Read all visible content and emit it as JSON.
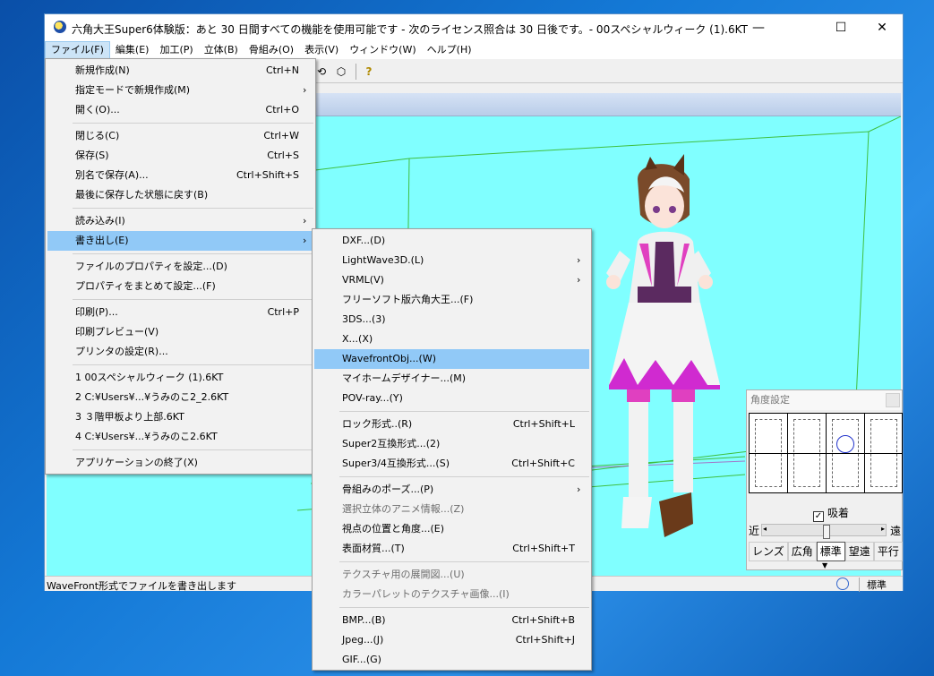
{
  "window": {
    "title": "六角大王Super6体験版：あと 30 日間すべての機能を使用可能です - 次のライセンス照合は 30 日後です。- 00スペシャルウィーク (1).6KT",
    "minimize": "—",
    "maximize": "☐",
    "close": "✕"
  },
  "menubar": [
    {
      "label": "ファイル(F)",
      "active": true
    },
    {
      "label": "編集(E)"
    },
    {
      "label": "加工(P)"
    },
    {
      "label": "立体(B)"
    },
    {
      "label": "骨組み(O)"
    },
    {
      "label": "表示(V)"
    },
    {
      "label": "ウィンドウ(W)"
    },
    {
      "label": "ヘルプ(H)"
    }
  ],
  "toolbar": {
    "help_icon": "?"
  },
  "file_menu": [
    {
      "label": "新規作成(N)",
      "shortcut": "Ctrl+N"
    },
    {
      "label": "指定モードで新規作成(M)",
      "submenu": true
    },
    {
      "label": "開く(O)...",
      "shortcut": "Ctrl+O"
    },
    {
      "sep": true
    },
    {
      "label": "閉じる(C)",
      "shortcut": "Ctrl+W"
    },
    {
      "label": "保存(S)",
      "shortcut": "Ctrl+S"
    },
    {
      "label": "別名で保存(A)...",
      "shortcut": "Ctrl+Shift+S"
    },
    {
      "label": "最後に保存した状態に戻す(B)"
    },
    {
      "sep": true
    },
    {
      "label": "読み込み(I)",
      "submenu": true
    },
    {
      "label": "書き出し(E)",
      "submenu": true,
      "highlighted": true
    },
    {
      "sep": true
    },
    {
      "label": "ファイルのプロパティを設定...(D)"
    },
    {
      "label": "プロパティをまとめて設定...(F)"
    },
    {
      "sep": true
    },
    {
      "label": "印刷(P)...",
      "shortcut": "Ctrl+P"
    },
    {
      "label": "印刷プレビュー(V)"
    },
    {
      "label": "プリンタの設定(R)..."
    },
    {
      "sep": true
    },
    {
      "label": "1 00スペシャルウィーク (1).6KT"
    },
    {
      "label": "2 C:¥Users¥...¥うみのこ2_2.6KT"
    },
    {
      "label": "3 ３階甲板より上部.6KT"
    },
    {
      "label": "4 C:¥Users¥...¥うみのこ2.6KT"
    },
    {
      "sep": true
    },
    {
      "label": "アプリケーションの終了(X)"
    }
  ],
  "export_menu": [
    {
      "label": "DXF...(D)"
    },
    {
      "label": "LightWave3D.(L)",
      "submenu": true
    },
    {
      "label": "VRML(V)",
      "submenu": true
    },
    {
      "label": "フリーソフト版六角大王...(F)"
    },
    {
      "label": "3DS...(3)"
    },
    {
      "label": "X...(X)"
    },
    {
      "label": "WavefrontObj...(W)",
      "highlighted": true
    },
    {
      "label": "マイホームデザイナー...(M)"
    },
    {
      "label": "POV-ray...(Y)"
    },
    {
      "sep": true
    },
    {
      "label": "ロック形式..(R)",
      "shortcut": "Ctrl+Shift+L"
    },
    {
      "label": "Super2互換形式...(2)"
    },
    {
      "label": "Super3/4互換形式...(S)",
      "shortcut": "Ctrl+Shift+C"
    },
    {
      "sep": true
    },
    {
      "label": "骨組みのポーズ...(P)",
      "submenu": true
    },
    {
      "label": "選択立体のアニメ情報...(Z)",
      "disabled": true
    },
    {
      "label": "視点の位置と角度...(E)"
    },
    {
      "label": "表面材質...(T)",
      "shortcut": "Ctrl+Shift+T"
    },
    {
      "sep": true
    },
    {
      "label": "テクスチャ用の展開図...(U)",
      "disabled": true
    },
    {
      "label": "カラーパレットのテクスチャ画像...(I)",
      "disabled": true
    },
    {
      "sep": true
    },
    {
      "label": "BMP...(B)",
      "shortcut": "Ctrl+Shift+B"
    },
    {
      "label": "Jpeg...(J)",
      "shortcut": "Ctrl+Shift+J"
    },
    {
      "label": "GIF...(G)"
    }
  ],
  "angle_panel": {
    "title": "角度設定",
    "snap_label": "吸着",
    "snap_checked": true,
    "near": "近",
    "far": "遠",
    "lens_buttons": [
      "レンズ",
      "広角",
      "標準",
      "望遠",
      "平行"
    ],
    "lens_selected": "標準"
  },
  "status": {
    "text": "WaveFront形式でファイルを書き出します",
    "right": "標準"
  },
  "colors": {
    "viewport_bg": "#80ffff",
    "menu_highlight": "#91c9f7",
    "grid_line": "#3fbf3f"
  }
}
